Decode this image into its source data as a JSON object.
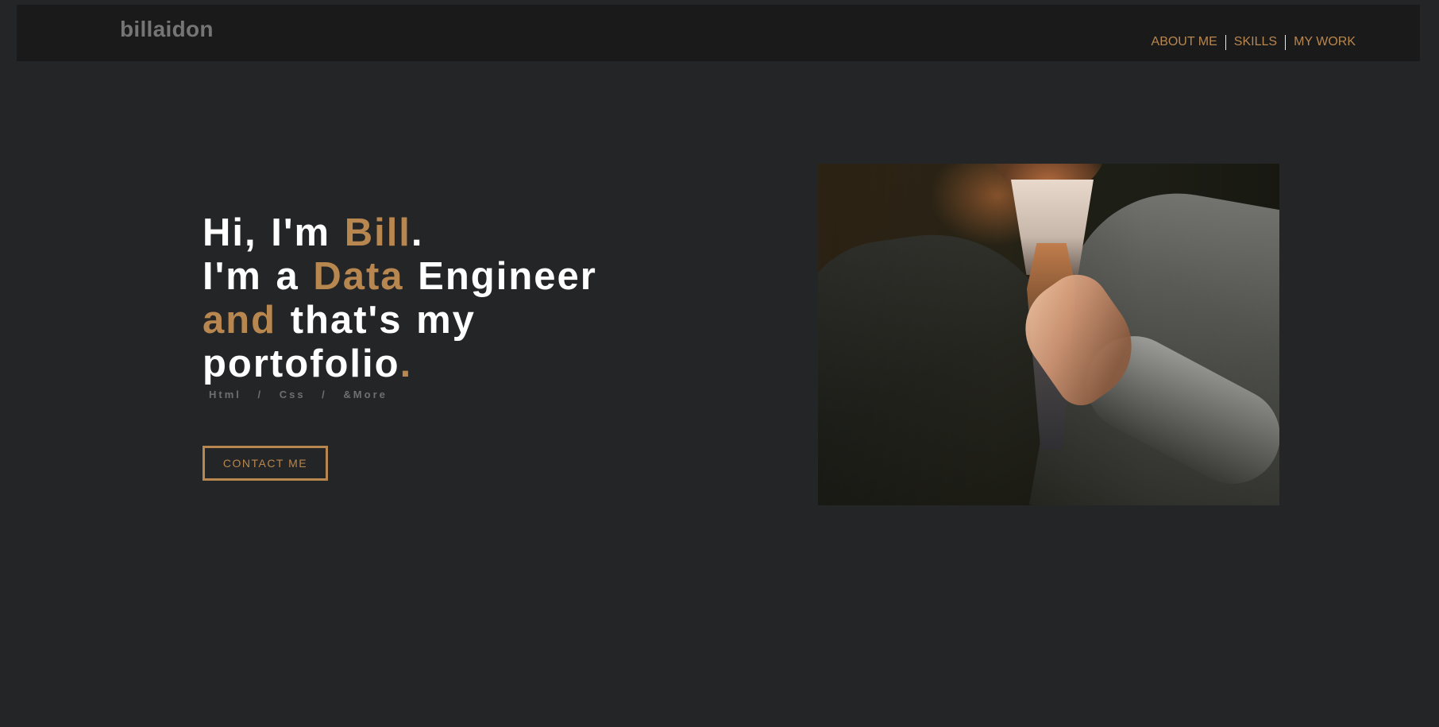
{
  "header": {
    "brand": "billaidon",
    "nav": [
      {
        "label": "ABOUT ME"
      },
      {
        "label": "SKILLS"
      },
      {
        "label": "MY WORK"
      }
    ]
  },
  "hero": {
    "line1": {
      "pre": "Hi, I'm ",
      "accent": "Bill",
      "post": "."
    },
    "line2": {
      "pre": "I'm a ",
      "accent": "Data",
      "post": " Engineer"
    },
    "line3": {
      "accent": "and",
      "post": " that's my"
    },
    "line4": {
      "pre": "portofolio",
      "accent": "."
    },
    "tech": "Html / Css / &More",
    "contact_label": "CONTACT ME"
  },
  "image": {
    "subject": "man in grey suit adjusting orange tie"
  },
  "colors": {
    "background": "#242527",
    "navbar": "#1a1a1a",
    "accent": "#b8864f",
    "brand_text": "#757575",
    "heading_text": "#ffffff",
    "muted_text": "#6f6f6f"
  }
}
